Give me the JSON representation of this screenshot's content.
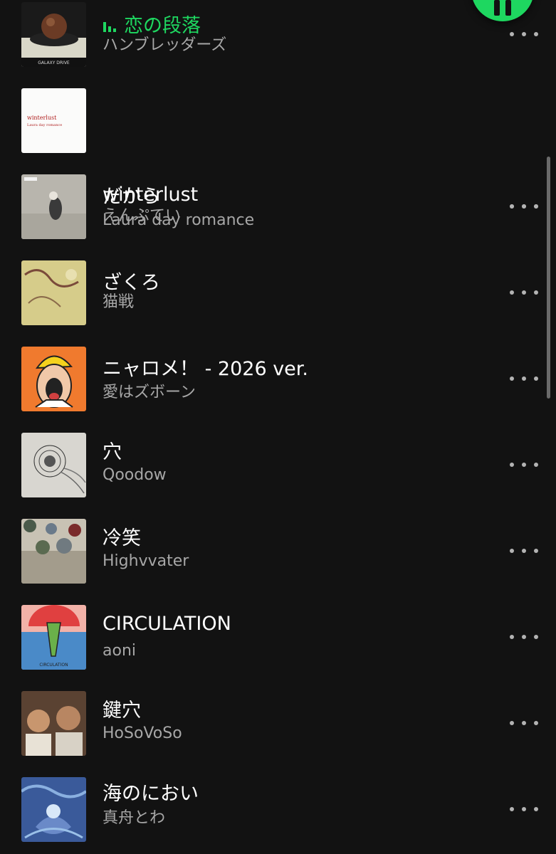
{
  "colors": {
    "background": "#121212",
    "accent": "#1ed760",
    "title": "#ffffff",
    "subtitle": "#a7a7a7"
  },
  "play_button": {
    "icon": "pause-icon"
  },
  "tracks": [
    {
      "title": "恋の段落",
      "artist": "ハンブレッダーズ",
      "now_playing": true,
      "art_caption": "GALAXY DRIVE"
    },
    {
      "title": "winterlust",
      "artist": "Laura day romance",
      "art_caption": "winterlust",
      "art_caption2": "Laura day romance"
    },
    {
      "title": "だから",
      "artist": "えんぷてい"
    },
    {
      "title": "ざくろ",
      "artist": "猫戦"
    },
    {
      "title": "ニャロメ！ - 2026 ver.",
      "artist": "愛はズボーン"
    },
    {
      "title": "穴",
      "artist": "Qoodow"
    },
    {
      "title": "冷笑",
      "artist": "Highvvater"
    },
    {
      "title": "CIRCULATION",
      "artist": "aoni",
      "art_caption": "CIRCULATION"
    },
    {
      "title": "鍵穴",
      "artist": "HoSoVoSo"
    },
    {
      "title": "海のにおい",
      "artist": "真舟とわ"
    }
  ]
}
